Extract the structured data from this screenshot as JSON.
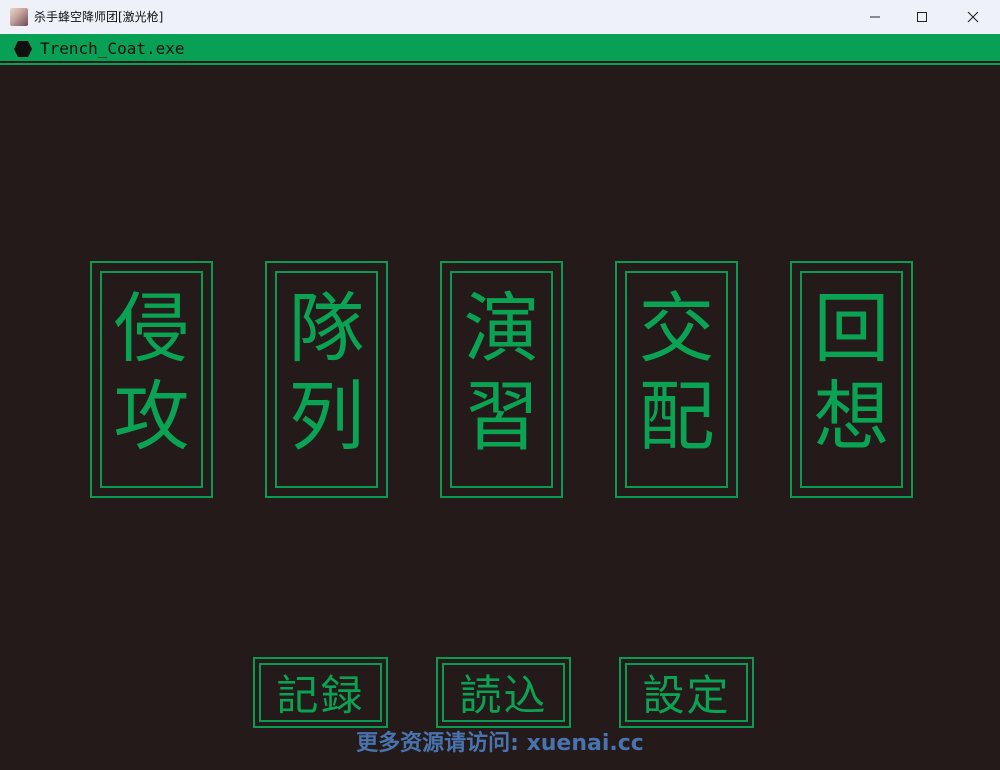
{
  "window": {
    "title": "杀手蜂空降师团[激光枪]",
    "minimize_icon": "minimize-icon",
    "maximize_icon": "maximize-icon",
    "close_icon": "close-icon"
  },
  "header": {
    "icon": "hexagon-icon",
    "exe_name": "Trench_Coat.exe",
    "accent_color": "#07a054"
  },
  "menu": {
    "items": [
      {
        "top": "侵",
        "bottom": "攻"
      },
      {
        "top": "隊",
        "bottom": "列"
      },
      {
        "top": "演",
        "bottom": "習"
      },
      {
        "top": "交",
        "bottom": "配"
      },
      {
        "top": "回",
        "bottom": "想"
      }
    ]
  },
  "system_buttons": {
    "save": "記録",
    "load": "読込",
    "settings": "設定"
  },
  "watermark": "更多资源请访问: xuenai.cc"
}
